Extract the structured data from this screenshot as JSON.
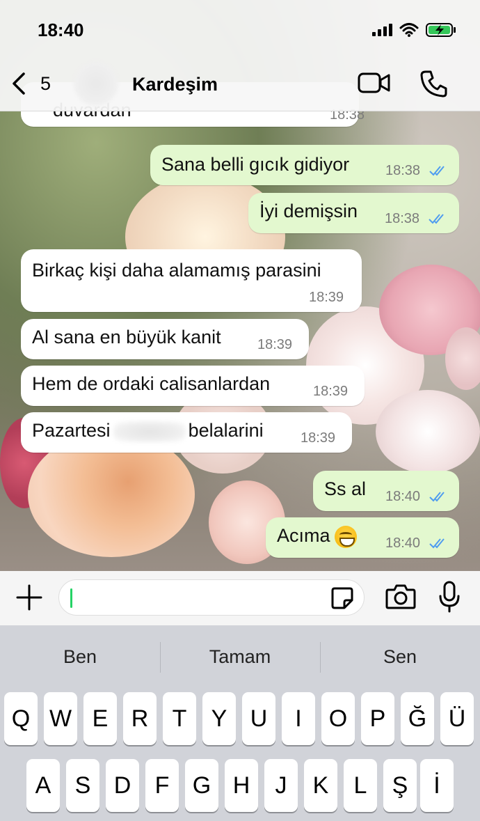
{
  "status_bar": {
    "time": "18:40"
  },
  "header": {
    "back_count": "5",
    "contact_name": "Kardeşim"
  },
  "messages": [
    {
      "direction": "in",
      "text": "duvardan",
      "time": "18:38"
    },
    {
      "direction": "out",
      "text": "Sana belli gıcık gidiyor",
      "time": "18:38",
      "read": true
    },
    {
      "direction": "out",
      "text": "İyi demişsin",
      "time": "18:38",
      "read": true
    },
    {
      "direction": "in",
      "text": "Birkaç kişi daha alamamış parasini",
      "time": "18:39"
    },
    {
      "direction": "in",
      "text": "Al sana en büyük kanit",
      "time": "18:39"
    },
    {
      "direction": "in",
      "text": "Hem de ordaki calisanlardan",
      "time": "18:39"
    },
    {
      "direction": "in",
      "text_before": "Pazartesi",
      "text_after": "belalarini",
      "time": "18:39",
      "redacted": true
    },
    {
      "direction": "out",
      "text": "Ss al",
      "time": "18:40",
      "read": true
    },
    {
      "direction": "out",
      "text": "Acıma",
      "emoji": "grinning-face",
      "time": "18:40",
      "read": true
    }
  ],
  "input": {
    "value": ""
  },
  "keyboard": {
    "suggestions": [
      "Ben",
      "Tamam",
      "Sen"
    ],
    "row1": [
      "Q",
      "W",
      "E",
      "R",
      "T",
      "Y",
      "U",
      "I",
      "O",
      "P",
      "Ğ",
      "Ü"
    ],
    "row2": [
      "A",
      "S",
      "D",
      "F",
      "G",
      "H",
      "J",
      "K",
      "L",
      "Ş",
      "İ"
    ]
  },
  "colors": {
    "outgoing_bubble": "#e3f8cf",
    "incoming_bubble": "#ffffff",
    "read_ticks": "#4f9cf0",
    "accent": "#25d366"
  }
}
